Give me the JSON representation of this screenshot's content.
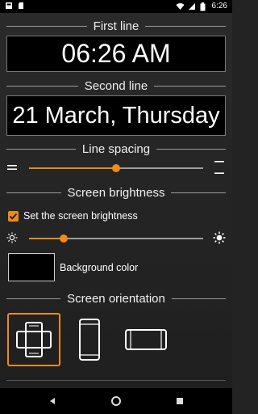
{
  "status_bar": {
    "time": "6:26"
  },
  "sections": {
    "first_line": {
      "title": "First line",
      "value": "06:26 AM"
    },
    "second_line": {
      "title": "Second line",
      "value": "21 March, Thursday"
    },
    "line_spacing": {
      "title": "Line spacing",
      "value_fraction": 0.5
    },
    "screen_brightness": {
      "title": "Screen brightness",
      "checkbox_label": "Set the screen brightness",
      "checked": true,
      "value_fraction": 0.2
    },
    "background_color": {
      "label": "Background color",
      "color": "#000000"
    },
    "screen_orientation": {
      "title": "Screen orientation",
      "options": [
        "auto-rotate",
        "portrait",
        "landscape"
      ],
      "selected": "auto-rotate"
    }
  },
  "colors": {
    "accent": "#ef8a19",
    "background": "#232323"
  }
}
